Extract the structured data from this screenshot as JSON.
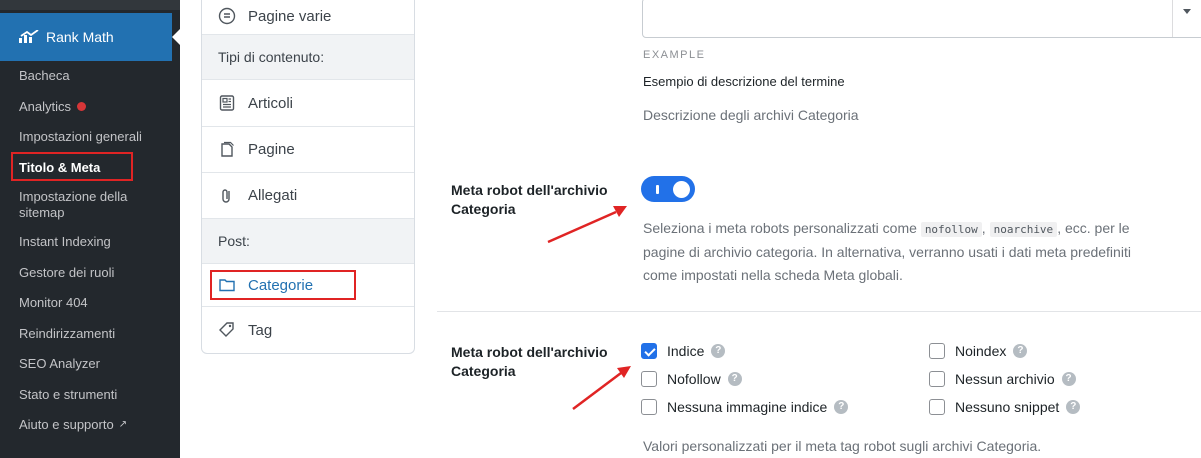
{
  "colors": {
    "accent": "#2271e8",
    "highlight": "#e02424",
    "sidebar_bg": "#23282d"
  },
  "sidebar": {
    "brand": "Rank Math",
    "items": [
      {
        "label": "Bacheca"
      },
      {
        "label": "Analytics"
      },
      {
        "label": "Impostazioni generali"
      },
      {
        "label": "Titolo & Meta"
      },
      {
        "label": "Impostazione della sitemap"
      },
      {
        "label": "Instant Indexing"
      },
      {
        "label": "Gestore dei ruoli"
      },
      {
        "label": "Monitor 404"
      },
      {
        "label": "Reindirizzamenti"
      },
      {
        "label": "SEO Analyzer"
      },
      {
        "label": "Stato e strumenti"
      },
      {
        "label": "Aiuto e supporto"
      }
    ]
  },
  "settings_nav": {
    "top_item": "Pagine varie",
    "section_content_types": "Tipi di contenuto:",
    "items_content": [
      {
        "label": "Articoli",
        "icon": "document-icon"
      },
      {
        "label": "Pagine",
        "icon": "pages-icon"
      },
      {
        "label": "Allegati",
        "icon": "paperclip-icon"
      }
    ],
    "section_post": "Post:",
    "items_post": [
      {
        "label": "Categorie",
        "icon": "folder-icon"
      },
      {
        "label": "Tag",
        "icon": "tag-icon"
      }
    ]
  },
  "main": {
    "example_label": "EXAMPLE",
    "example_text": "Esempio di descrizione del termine",
    "archive_description": "Descrizione degli archivi Categoria",
    "robots_toggle": {
      "label": "Meta robot dell'archivio Categoria",
      "enabled": true,
      "desc_before": "Seleziona i meta robots personalizzati come",
      "kw1": "nofollow",
      "comma": ",",
      "kw2": "noarchive",
      "desc_after_line1": ", ecc. per le",
      "desc_line2": "pagine di archivio categoria. In alternativa, verranno usati i dati meta predefiniti",
      "desc_line3": "come impostati nella scheda Meta globali."
    },
    "robots_checkboxes": {
      "label": "Meta robot dell'archivio Categoria",
      "options": [
        {
          "label": "Indice",
          "checked": true
        },
        {
          "label": "Noindex",
          "checked": false
        },
        {
          "label": "Nofollow",
          "checked": false
        },
        {
          "label": "Nessun archivio",
          "checked": false
        },
        {
          "label": "Nessuna immagine indice",
          "checked": false
        },
        {
          "label": "Nessuno snippet",
          "checked": false
        }
      ],
      "help_glyph": "?",
      "footer": "Valori personalizzati per il meta tag robot sugli archivi Categoria."
    }
  }
}
